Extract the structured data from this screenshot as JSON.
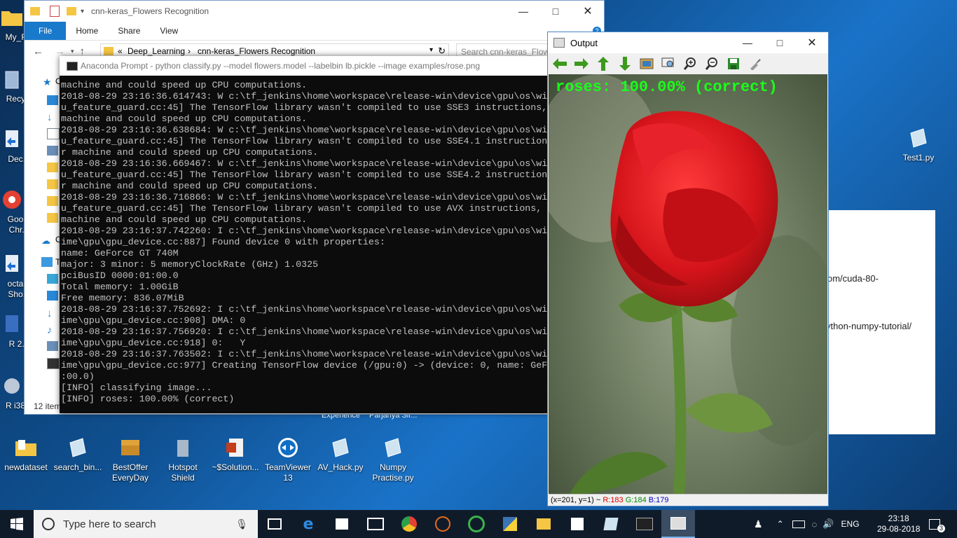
{
  "desktop": {
    "left_icons": [
      {
        "label": "My_F..."
      },
      {
        "label": "Recy..."
      },
      {
        "label": "Dec..."
      },
      {
        "label": "Goo...\nChr..."
      },
      {
        "label": "octa...\nSho..."
      },
      {
        "label": "R 2..."
      },
      {
        "label": "R i38..."
      }
    ],
    "bottom_icons": [
      {
        "label": "newdataset",
        "icon": "folder-icon"
      },
      {
        "label": "search_bin...",
        "icon": "python-file-icon"
      },
      {
        "label": "BestOffer\nEveryDay",
        "icon": "treasure-chest-icon"
      },
      {
        "label": "Hotspot\nShield",
        "icon": "trash-bin-icon"
      },
      {
        "label": "~$Solution...",
        "icon": "powerpoint-icon"
      },
      {
        "label": "TeamViewer\n13",
        "icon": "teamviewer-icon"
      },
      {
        "label": "AV_Hack.py",
        "icon": "python-file-icon"
      },
      {
        "label": "Numpy\nPractise.py",
        "icon": "python-file-icon"
      }
    ],
    "hidden_row_text": [
      "Experience",
      "Parjanya Sir..."
    ],
    "right_icon": {
      "label": "Test1.py"
    }
  },
  "explorer": {
    "title": "cnn-keras_Flowers Recognition",
    "ribbon_tabs": [
      "File",
      "Home",
      "Share",
      "View"
    ],
    "breadcrumb": [
      "Deep_Learning",
      "cnn-keras_Flowers Recognition"
    ],
    "breadcrumb_prefix": "«",
    "search_placeholder": "Search cnn-keras_Flowe...",
    "item_count": "12 item",
    "nav_labels": [
      "O",
      "O",
      "T"
    ]
  },
  "conda": {
    "title": "Anaconda Prompt - python  classify.py --model flowers.model --labelbin lb.pickle --image examples/rose.png",
    "lines": [
      "machine and could speed up CPU computations.",
      "2018-08-29 23:16:36.614743: W c:\\tf_jenkins\\home\\workspace\\release-win\\device\\gpu\\os\\wi",
      "u_feature_guard.cc:45] The TensorFlow library wasn't compiled to use SSE3 instructions,",
      "machine and could speed up CPU computations.",
      "2018-08-29 23:16:36.638684: W c:\\tf_jenkins\\home\\workspace\\release-win\\device\\gpu\\os\\wi",
      "u_feature_guard.cc:45] The TensorFlow library wasn't compiled to use SSE4.1 instruction",
      "r machine and could speed up CPU computations.",
      "2018-08-29 23:16:36.669467: W c:\\tf_jenkins\\home\\workspace\\release-win\\device\\gpu\\os\\wi",
      "u_feature_guard.cc:45] The TensorFlow library wasn't compiled to use SSE4.2 instruction",
      "r machine and could speed up CPU computations.",
      "2018-08-29 23:16:36.716866: W c:\\tf_jenkins\\home\\workspace\\release-win\\device\\gpu\\os\\wi",
      "u_feature_guard.cc:45] The TensorFlow library wasn't compiled to use AVX instructions,",
      "machine and could speed up CPU computations.",
      "2018-08-29 23:16:37.742260: I c:\\tf_jenkins\\home\\workspace\\release-win\\device\\gpu\\os\\wi",
      "ime\\gpu\\gpu_device.cc:887] Found device 0 with properties:",
      "name: GeForce GT 740M",
      "major: 3 minor: 5 memoryClockRate (GHz) 1.0325",
      "pciBusID 0000:01:00.0",
      "Total memory: 1.00GiB",
      "Free memory: 836.07MiB",
      "2018-08-29 23:16:37.752692: I c:\\tf_jenkins\\home\\workspace\\release-win\\device\\gpu\\os\\wi",
      "ime\\gpu\\gpu_device.cc:908] DMA: 0",
      "2018-08-29 23:16:37.756920: I c:\\tf_jenkins\\home\\workspace\\release-win\\device\\gpu\\os\\wi",
      "ime\\gpu\\gpu_device.cc:918] 0:   Y",
      "2018-08-29 23:16:37.763502: I c:\\tf_jenkins\\home\\workspace\\release-win\\device\\gpu\\os\\wi",
      "ime\\gpu\\gpu_device.cc:977] Creating TensorFlow device (/gpu:0) -> (device: 0, name: GeF",
      ":00.0)",
      "[INFO] classifying image...",
      "[INFO] roses: 100.00% (correct)"
    ]
  },
  "output": {
    "title": "Output",
    "prediction": "roses: 100.00% (correct)",
    "status": {
      "coords": "(x=201, y=1) ~",
      "r": "R:183",
      "g": "G:184",
      "b": "B:179"
    },
    "tools": [
      "arrow-left-icon",
      "arrow-right-icon",
      "arrow-up-icon",
      "arrow-down-icon",
      "image-icon",
      "zoom-fit-icon",
      "zoom-in-icon",
      "zoom-out-icon",
      "save-icon",
      "properties-icon"
    ]
  },
  "browser_text": [
    "om/cuda-80-",
    "ython-numpy-tutorial/"
  ],
  "taskbar": {
    "search_placeholder": "Type here to search",
    "language": "ENG",
    "time": "23:18",
    "date": "29-08-2018",
    "notifications": "3"
  },
  "colors": {
    "accent": "#1979ca",
    "prediction": "#1aff1a",
    "taskbar": "#101b2a"
  }
}
